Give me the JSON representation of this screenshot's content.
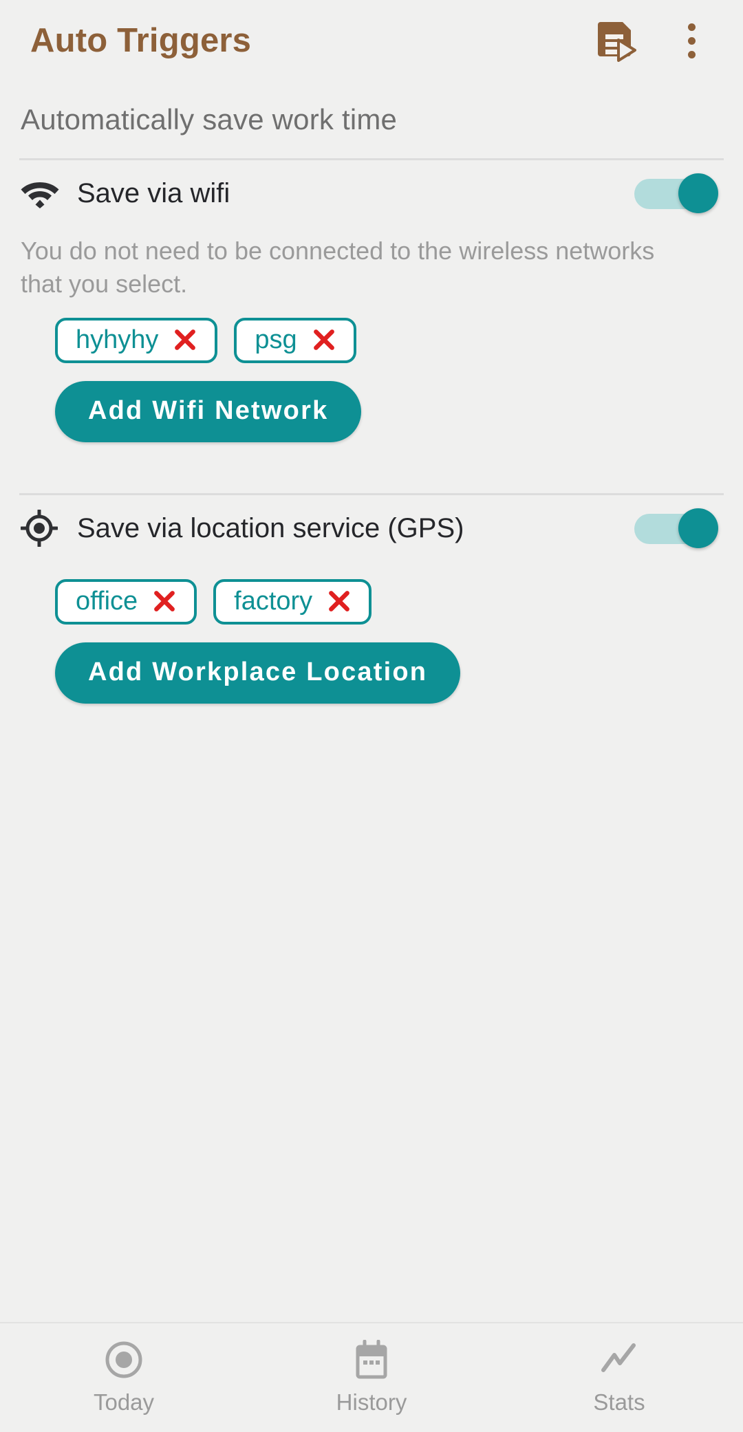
{
  "appbar": {
    "title": "Auto Triggers",
    "export_icon": "document-play-icon",
    "overflow_icon": "more-vertical-icon",
    "accent_color": "#8D6039"
  },
  "section": {
    "header": "Automatically save work time"
  },
  "wifi": {
    "icon": "wifi-icon",
    "label": "Save via wifi",
    "toggle_on": true,
    "description": "You do not need to be connected to the wireless networks that you select.",
    "chips": [
      {
        "label": "hyhyhy",
        "remove_icon": "close-icon"
      },
      {
        "label": "psg",
        "remove_icon": "close-icon"
      }
    ],
    "add_button": "Add Wifi Network"
  },
  "gps": {
    "icon": "gps-crosshair-icon",
    "label": "Save via location service (GPS)",
    "toggle_on": true,
    "chips": [
      {
        "label": "office",
        "remove_icon": "close-icon"
      },
      {
        "label": "factory",
        "remove_icon": "close-icon"
      }
    ],
    "add_button": "Add Workplace Location"
  },
  "bottom_nav": {
    "items": [
      {
        "label": "Today",
        "icon": "record-circle-icon"
      },
      {
        "label": "History",
        "icon": "calendar-icon"
      },
      {
        "label": "Stats",
        "icon": "trend-line-icon"
      }
    ]
  },
  "colors": {
    "teal": "#0E9094",
    "teal_track": "#B2DCDC",
    "brown": "#8D6039",
    "red": "#E02020",
    "background": "#F0F0EF"
  }
}
